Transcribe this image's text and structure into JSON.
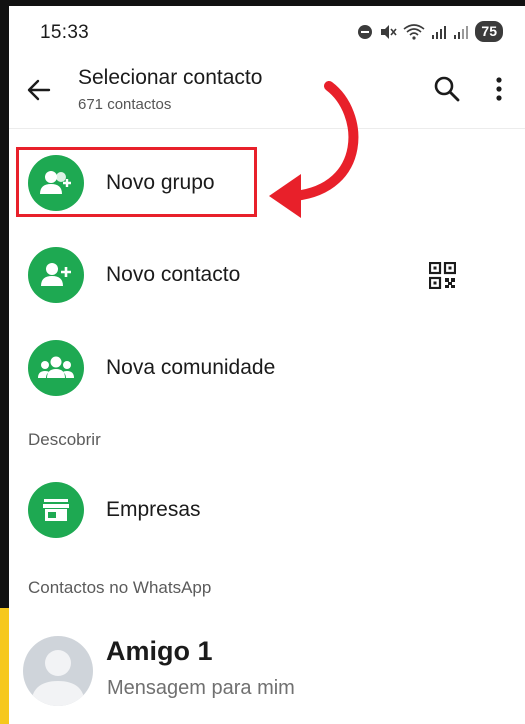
{
  "status_bar": {
    "time": "15:33",
    "battery": "75"
  },
  "app_bar": {
    "title": "Selecionar contacto",
    "subtitle": "671 contactos",
    "back_icon": "arrow-left-icon",
    "search_icon": "search-icon",
    "menu_icon": "more-vert-icon"
  },
  "actions": [
    {
      "label": "Novo grupo",
      "icon": "group-add-icon",
      "highlighted": true
    },
    {
      "label": "Novo contacto",
      "icon": "person-add-icon",
      "trailing_icon": "qr-code-icon"
    },
    {
      "label": "Nova comunidade",
      "icon": "community-icon"
    }
  ],
  "sections": {
    "discover": "Descobrir",
    "contacts": "Contactos no WhatsApp"
  },
  "discover_items": [
    {
      "label": "Empresas",
      "icon": "storefront-icon"
    }
  ],
  "contacts": [
    {
      "name": "Amigo 1",
      "status": "Mensagem para mim",
      "avatar": "default-avatar-icon"
    }
  ],
  "colors": {
    "accent_green": "#1ea952",
    "annotation_red": "#e8202a"
  }
}
